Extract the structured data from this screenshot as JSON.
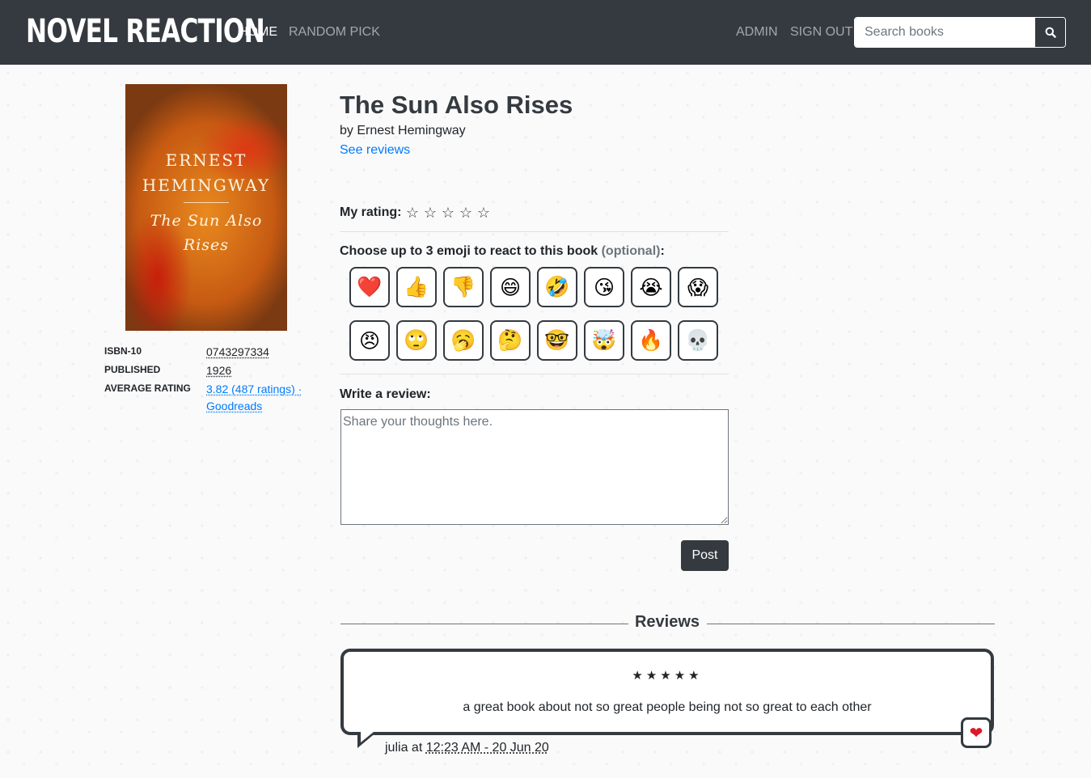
{
  "nav": {
    "brand": "NOVEL REACTION",
    "home": "HOME",
    "random_pick": "RANDOM PICK",
    "admin": "ADMIN",
    "sign_out": "SIGN OUT",
    "search_placeholder": "Search books"
  },
  "book": {
    "title": "The Sun Also Rises",
    "byline": "by Ernest Hemingway",
    "see_reviews": "See reviews",
    "cover": {
      "author_line1": "ERNEST",
      "author_line2": "HEMINGWAY",
      "title_line1": "The Sun Also",
      "title_line2": "Rises"
    },
    "meta": {
      "isbn_label": "ISBN-10",
      "isbn_value": "0743297334",
      "published_label": "PUBLISHED",
      "published_value": "1926",
      "avg_label": "AVERAGE RATING",
      "avg_value_line1": "3.82 (487 ratings) ·",
      "avg_value_line2": "Goodreads"
    }
  },
  "rating": {
    "label": "My rating:",
    "stars": [
      "☆",
      "☆",
      "☆",
      "☆",
      "☆"
    ]
  },
  "emoji": {
    "label": "Choose up to 3 emoji to react to this book",
    "optional": "(optional)",
    "colon": ":",
    "options": [
      {
        "name": "heart",
        "glyph": "❤️"
      },
      {
        "name": "thumbs-up",
        "glyph": "👍"
      },
      {
        "name": "thumbs-down",
        "glyph": "👎"
      },
      {
        "name": "grinning",
        "glyph": "😄"
      },
      {
        "name": "rofl",
        "glyph": "🤣"
      },
      {
        "name": "kissing-heart",
        "glyph": "😘"
      },
      {
        "name": "crying",
        "glyph": "😭"
      },
      {
        "name": "screaming",
        "glyph": "😱"
      },
      {
        "name": "angry",
        "glyph": "😠"
      },
      {
        "name": "eye-roll",
        "glyph": "🙄"
      },
      {
        "name": "yawning",
        "glyph": "🥱"
      },
      {
        "name": "thinking",
        "glyph": "🤔"
      },
      {
        "name": "nerd",
        "glyph": "🤓"
      },
      {
        "name": "mind-blown",
        "glyph": "🤯"
      },
      {
        "name": "fire",
        "glyph": "🔥"
      },
      {
        "name": "skull",
        "glyph": "💀"
      }
    ]
  },
  "review_form": {
    "label": "Write a review:",
    "placeholder": "Share your thoughts here.",
    "post": "Post"
  },
  "reviews": {
    "heading": "Reviews",
    "items": [
      {
        "stars": "★★★★★",
        "text": "a great book about not so great people being not so great to each other",
        "reaction": "❤",
        "author": "julia",
        "at": "at",
        "time": "12:23 AM - 20 Jun 20"
      }
    ]
  },
  "colors": {
    "navbar": "#343a40",
    "link": "#007bff",
    "heart": "#e0162b"
  }
}
